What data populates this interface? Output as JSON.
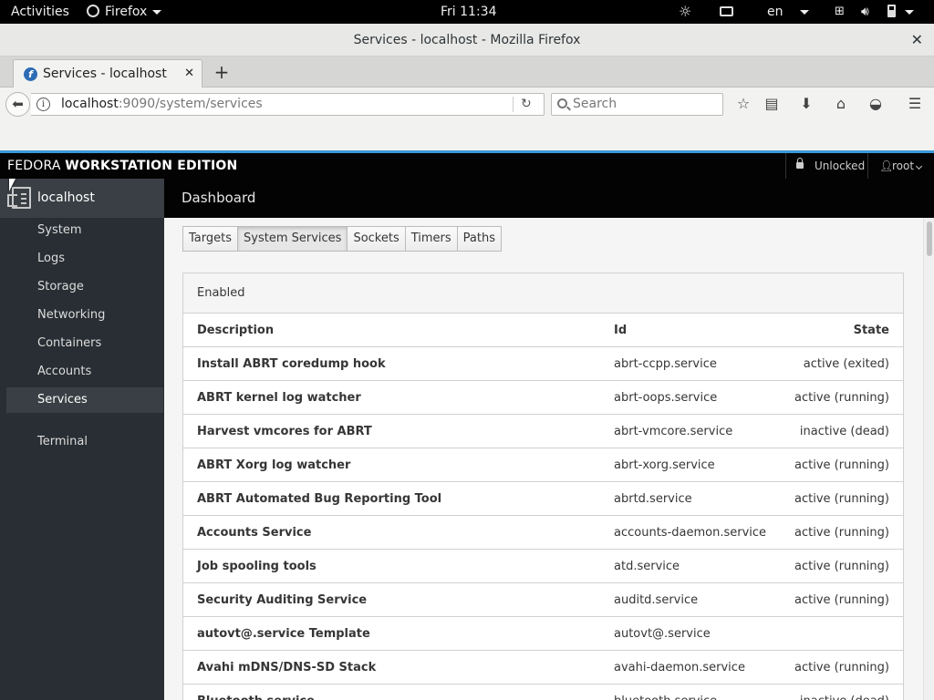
{
  "topbar": {
    "activities": "Activities",
    "app_name": "Firefox",
    "clock": "Fri 11:34",
    "language": "en"
  },
  "window": {
    "title": "Services - localhost - Mozilla Firefox",
    "close": "✕"
  },
  "browser": {
    "tab_label": "Services - localhost",
    "tab_close": "✕",
    "new_tab": "+",
    "url_host": "localhost",
    "url_rest": ":9090/system/services",
    "search_placeholder": "Search"
  },
  "cockpit": {
    "brand_light": "FEDORA ",
    "brand_bold": "WORKSTATION EDITION",
    "unlocked": "Unlocked",
    "user": "root",
    "host": "localhost",
    "nav": [
      "System",
      "Logs",
      "Storage",
      "Networking",
      "Containers",
      "Accounts",
      "Services",
      "Terminal"
    ],
    "active_nav": "Services",
    "breadcrumb": "Dashboard"
  },
  "service_tabs": [
    "Targets",
    "System Services",
    "Sockets",
    "Timers",
    "Paths"
  ],
  "active_service_tab": "System Services",
  "panel": {
    "heading": "Enabled",
    "columns": {
      "description": "Description",
      "id": "Id",
      "state": "State"
    },
    "rows": [
      {
        "description": "Install ABRT coredump hook",
        "id": "abrt-ccpp.service",
        "state": "active (exited)"
      },
      {
        "description": "ABRT kernel log watcher",
        "id": "abrt-oops.service",
        "state": "active (running)"
      },
      {
        "description": "Harvest vmcores for ABRT",
        "id": "abrt-vmcore.service",
        "state": "inactive (dead)"
      },
      {
        "description": "ABRT Xorg log watcher",
        "id": "abrt-xorg.service",
        "state": "active (running)"
      },
      {
        "description": "ABRT Automated Bug Reporting Tool",
        "id": "abrtd.service",
        "state": "active (running)"
      },
      {
        "description": "Accounts Service",
        "id": "accounts-daemon.service",
        "state": "active (running)"
      },
      {
        "description": "Job spooling tools",
        "id": "atd.service",
        "state": "active (running)"
      },
      {
        "description": "Security Auditing Service",
        "id": "auditd.service",
        "state": "active (running)"
      },
      {
        "description": "autovt@.service Template",
        "id": "autovt@.service",
        "state": ""
      },
      {
        "description": "Avahi mDNS/DNS-SD Stack",
        "id": "avahi-daemon.service",
        "state": "active (running)"
      },
      {
        "description": "Bluetooth service",
        "id": "bluetooth.service",
        "state": "inactive (dead)"
      }
    ]
  },
  "colors": {
    "cockpit_header": "#030303",
    "sidebar": "#292e34",
    "sidebar_active": "#393f44",
    "accent": "#3999d9"
  }
}
